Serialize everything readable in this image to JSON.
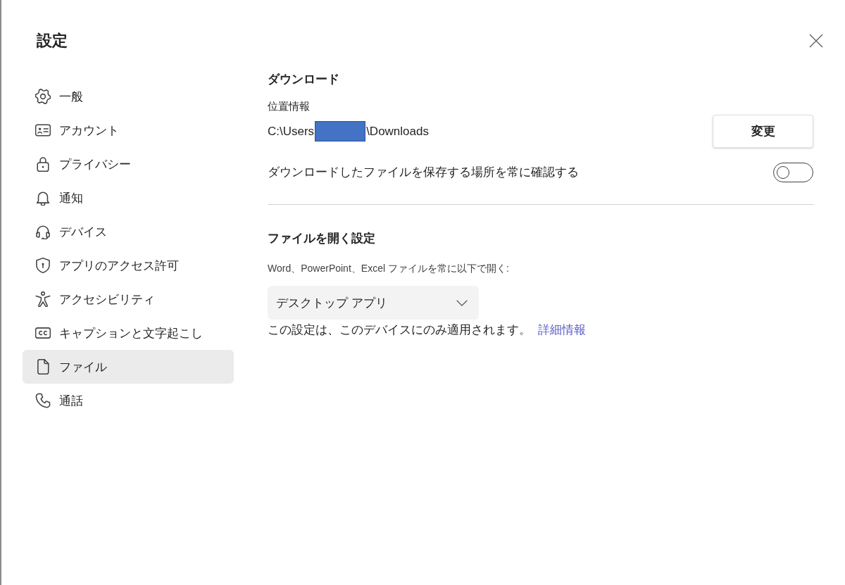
{
  "dialog": {
    "title": "設定"
  },
  "sidebar": {
    "items": [
      {
        "label": "一般",
        "selected": false
      },
      {
        "label": "アカウント",
        "selected": false
      },
      {
        "label": "プライバシー",
        "selected": false
      },
      {
        "label": "通知",
        "selected": false
      },
      {
        "label": "デバイス",
        "selected": false
      },
      {
        "label": "アプリのアクセス許可",
        "selected": false
      },
      {
        "label": "アクセシビリティ",
        "selected": false
      },
      {
        "label": "キャプションと文字起こし",
        "selected": false
      },
      {
        "label": "ファイル",
        "selected": true
      },
      {
        "label": "通話",
        "selected": false
      }
    ]
  },
  "download": {
    "heading": "ダウンロード",
    "location_label": "位置情報",
    "path": {
      "prefix": "C:\\Users",
      "redacted": true,
      "suffix": "\\Downloads"
    },
    "change_button": "変更",
    "always_ask": {
      "label": "ダウンロードしたファイルを保存する場所を常に確認する",
      "on": false
    }
  },
  "open_files": {
    "heading": "ファイルを開く設定",
    "prompt": "Word、PowerPoint、Excel ファイルを常に以下で開く:",
    "dropdown": {
      "value": "デスクトップ アプリ"
    },
    "note": "この設定は、このデバイスにのみ適用されます。",
    "link": "詳細情報"
  }
}
